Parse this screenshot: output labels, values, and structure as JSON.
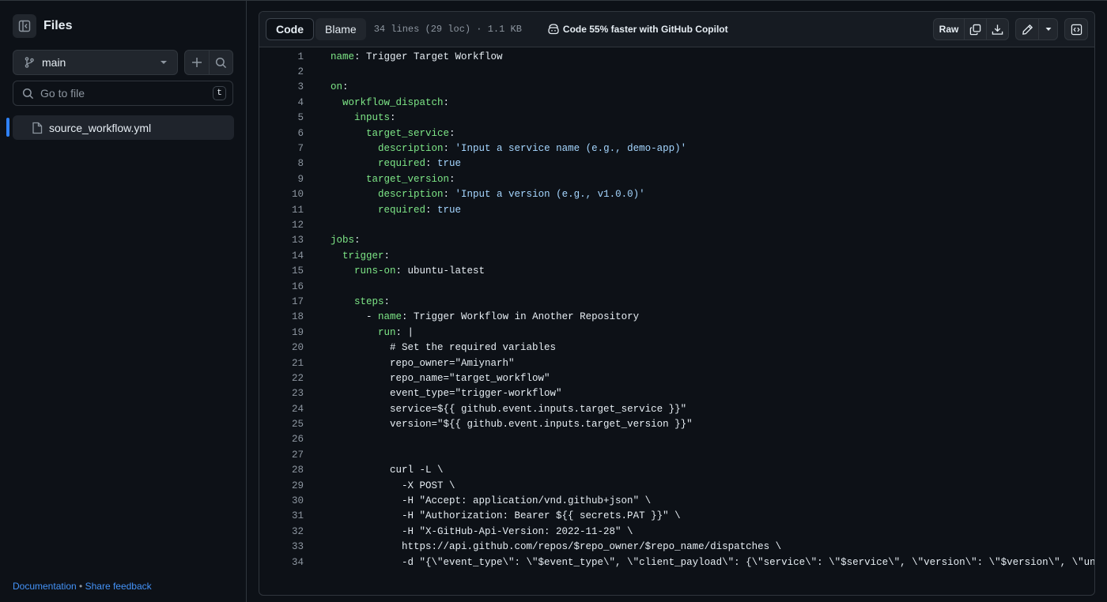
{
  "sidebar": {
    "title": "Files",
    "branch": "main",
    "goto_placeholder": "Go to file",
    "goto_shortcut": "t",
    "files": [
      {
        "name": "source_workflow.yml"
      }
    ],
    "footer": {
      "documentation": "Documentation",
      "separator": " • ",
      "feedback": "Share feedback"
    }
  },
  "header": {
    "tabs": {
      "code": "Code",
      "blame": "Blame"
    },
    "meta": "34 lines (29 loc) · 1.1 KB",
    "copilot": "Code 55% faster with GitHub Copilot",
    "raw": "Raw"
  },
  "icons": [
    "sidebar-collapse-icon",
    "git-branch-icon",
    "triangle-down-icon",
    "plus-icon",
    "search-icon",
    "file-icon",
    "copilot-icon",
    "copy-icon",
    "download-icon",
    "pencil-icon",
    "chevron-down-icon",
    "code-square-icon"
  ],
  "colors": {
    "background": "#0d1117",
    "header": "#161b22",
    "border": "#30363d",
    "yaml_key": "#7ee787",
    "yaml_value": "#a5d6ff",
    "link": "#4493f8",
    "active_bar": "#2f81f7"
  },
  "code_lines": [
    {
      "n": "1",
      "indent": "",
      "key": "name",
      "sep": ": ",
      "val": "Trigger Target Workflow"
    },
    {
      "n": "2",
      "indent": "",
      "key": "",
      "sep": "",
      "val": ""
    },
    {
      "n": "3",
      "indent": "",
      "key": "on",
      "sep": ":",
      "val": ""
    },
    {
      "n": "4",
      "indent": "  ",
      "key": "workflow_dispatch",
      "sep": ":",
      "val": ""
    },
    {
      "n": "5",
      "indent": "    ",
      "key": "inputs",
      "sep": ":",
      "val": ""
    },
    {
      "n": "6",
      "indent": "      ",
      "key": "target_service",
      "sep": ":",
      "val": ""
    },
    {
      "n": "7",
      "indent": "        ",
      "key": "description",
      "sep": ": ",
      "val": "'Input a service name (e.g., demo-app)'"
    },
    {
      "n": "8",
      "indent": "        ",
      "key": "required",
      "sep": ": ",
      "val": "true"
    },
    {
      "n": "9",
      "indent": "      ",
      "key": "target_version",
      "sep": ":",
      "val": ""
    },
    {
      "n": "10",
      "indent": "        ",
      "key": "description",
      "sep": ": ",
      "val": "'Input a version (e.g., v1.0.0)'"
    },
    {
      "n": "11",
      "indent": "        ",
      "key": "required",
      "sep": ": ",
      "val": "true"
    },
    {
      "n": "12",
      "indent": "",
      "key": "",
      "sep": "",
      "val": ""
    },
    {
      "n": "13",
      "indent": "",
      "key": "jobs",
      "sep": ":",
      "val": ""
    },
    {
      "n": "14",
      "indent": "  ",
      "key": "trigger",
      "sep": ":",
      "val": ""
    },
    {
      "n": "15",
      "indent": "    ",
      "key": "runs-on",
      "sep": ": ",
      "val": "ubuntu-latest"
    },
    {
      "n": "16",
      "indent": "",
      "key": "",
      "sep": "",
      "val": ""
    },
    {
      "n": "17",
      "indent": "    ",
      "key": "steps",
      "sep": ":",
      "val": ""
    },
    {
      "n": "18",
      "indent": "      - ",
      "key": "name",
      "sep": ": ",
      "val": "Trigger Workflow in Another Repository"
    },
    {
      "n": "19",
      "indent": "        ",
      "key": "run",
      "sep": ": ",
      "val": "|"
    },
    {
      "n": "20",
      "indent": "          ",
      "key": "",
      "sep": "",
      "val": "# Set the required variables"
    },
    {
      "n": "21",
      "indent": "          ",
      "key": "",
      "sep": "",
      "val": "repo_owner=\"Amiynarh\""
    },
    {
      "n": "22",
      "indent": "          ",
      "key": "",
      "sep": "",
      "val": "repo_name=\"target_workflow\""
    },
    {
      "n": "23",
      "indent": "          ",
      "key": "",
      "sep": "",
      "val": "event_type=\"trigger-workflow\""
    },
    {
      "n": "24",
      "indent": "          ",
      "key": "",
      "sep": "",
      "val": "service=${{ github.event.inputs.target_service }}\""
    },
    {
      "n": "25",
      "indent": "          ",
      "key": "",
      "sep": "",
      "val": "version=\"${{ github.event.inputs.target_version }}\""
    },
    {
      "n": "26",
      "indent": "",
      "key": "",
      "sep": "",
      "val": ""
    },
    {
      "n": "27",
      "indent": "",
      "key": "",
      "sep": "",
      "val": ""
    },
    {
      "n": "28",
      "indent": "          ",
      "key": "",
      "sep": "",
      "val": "curl -L \\"
    },
    {
      "n": "29",
      "indent": "            ",
      "key": "",
      "sep": "",
      "val": "-X POST \\"
    },
    {
      "n": "30",
      "indent": "            ",
      "key": "",
      "sep": "",
      "val": "-H \"Accept: application/vnd.github+json\" \\"
    },
    {
      "n": "31",
      "indent": "            ",
      "key": "",
      "sep": "",
      "val": "-H \"Authorization: Bearer ${{ secrets.PAT }}\" \\"
    },
    {
      "n": "32",
      "indent": "            ",
      "key": "",
      "sep": "",
      "val": "-H \"X-GitHub-Api-Version: 2022-11-28\" \\"
    },
    {
      "n": "33",
      "indent": "            ",
      "key": "",
      "sep": "",
      "val": "https://api.github.com/repos/$repo_owner/$repo_name/dispatches \\"
    },
    {
      "n": "34",
      "indent": "            ",
      "key": "",
      "sep": "",
      "val": "-d \"{\\\"event_type\\\": \\\"$event_type\\\", \\\"client_payload\\\": {\\\"service\\\": \\\"$service\\\", \\\"version\\\": \\\"$version\\\", \\\"unit\\\": fals"
    }
  ]
}
